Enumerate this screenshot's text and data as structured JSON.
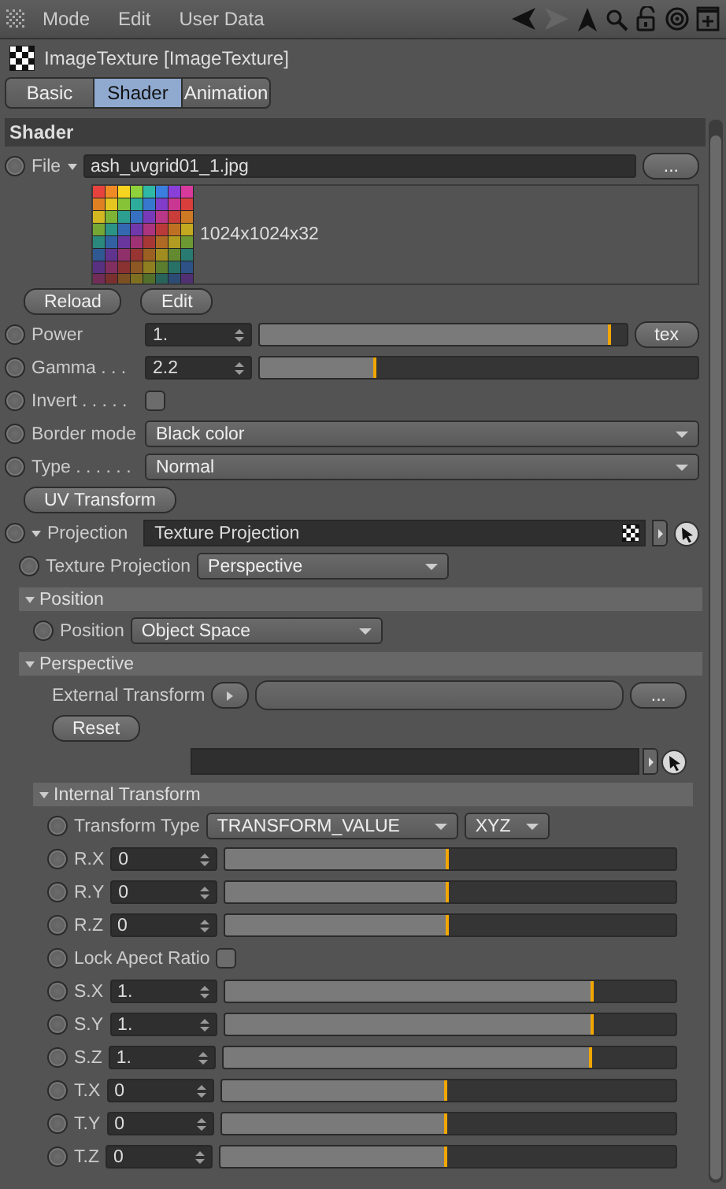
{
  "menu": {
    "items": [
      "Mode",
      "Edit",
      "User Data"
    ]
  },
  "object": {
    "title": "ImageTexture [ImageTexture]"
  },
  "tabs": [
    {
      "label": "Basic",
      "selected": false
    },
    {
      "label": "Shader",
      "selected": true
    },
    {
      "label": "Animation",
      "selected": false
    }
  ],
  "section": {
    "title": "Shader"
  },
  "file": {
    "label": "File",
    "keyed": false,
    "value": "ash_uvgrid01_1.jpg",
    "browse": "...",
    "resolution": "1024x1024x32",
    "buttons": [
      "Reload",
      "Edit"
    ]
  },
  "params": [
    {
      "kind": "slider",
      "label": "Power",
      "keyed": false,
      "value": "1.",
      "level": 0.95,
      "button": "tex"
    },
    {
      "kind": "slider",
      "label": "Gamma . . .",
      "keyed": false,
      "value": "2.2",
      "level": 0.26
    },
    {
      "kind": "checkbox",
      "label": "Invert . . . . .",
      "keyed": false,
      "checked": false
    },
    {
      "kind": "dropdown",
      "label": "Border mode",
      "keyed": false,
      "value": "Black color"
    },
    {
      "kind": "dropdown",
      "label": "Type . . . . . .",
      "keyed": false,
      "value": "Normal"
    },
    {
      "kind": "button",
      "label": "UV Transform"
    },
    {
      "kind": "link",
      "label": "Projection",
      "keyed": false,
      "value": "Texture Projection",
      "expanded": true,
      "children": [
        {
          "kind": "dropdown",
          "label": "Texture Projection",
          "keyed": false,
          "value": "Perspective"
        },
        {
          "kind": "group",
          "label": "Position",
          "expanded": true,
          "children": [
            {
              "kind": "dropdown",
              "label": "Position",
              "keyed": false,
              "value": "Object Space"
            }
          ]
        },
        {
          "kind": "group",
          "label": "Perspective",
          "expanded": true,
          "children": [
            {
              "kind": "transform_link",
              "label": "External Transform",
              "browse": "..."
            },
            {
              "kind": "button",
              "label": "Reset"
            },
            {
              "kind": "link_field"
            },
            {
              "kind": "group",
              "label": "Internal Transform",
              "expanded": true,
              "children": [
                {
                  "kind": "dropdown_pair",
                  "label": "Transform Type",
                  "keyed": false,
                  "value": "TRANSFORM_VALUE",
                  "value2": "XYZ"
                },
                {
                  "kind": "slider",
                  "label": "R.X",
                  "keyed": false,
                  "value": "0",
                  "level": 0.49
                },
                {
                  "kind": "slider",
                  "label": "R.Y",
                  "keyed": false,
                  "value": "0",
                  "level": 0.49
                },
                {
                  "kind": "slider",
                  "label": "R.Z",
                  "keyed": false,
                  "value": "0",
                  "level": 0.49
                },
                {
                  "kind": "checkbox",
                  "label": "Lock Apect Ratio",
                  "keyed": false,
                  "checked": false
                },
                {
                  "kind": "slider",
                  "label": "S.X",
                  "keyed": false,
                  "value": "1.",
                  "level": 0.81
                },
                {
                  "kind": "slider",
                  "label": "S.Y",
                  "keyed": false,
                  "value": "1.",
                  "level": 0.81
                },
                {
                  "kind": "slider",
                  "label": "S.Z",
                  "keyed": false,
                  "value": "1.",
                  "level": 0.81
                },
                {
                  "kind": "slider",
                  "label": "T.X",
                  "keyed": false,
                  "value": "0",
                  "level": 0.49
                },
                {
                  "kind": "slider",
                  "label": "T.Y",
                  "keyed": false,
                  "value": "0",
                  "level": 0.49
                },
                {
                  "kind": "slider",
                  "label": "T.Z",
                  "keyed": false,
                  "value": "0",
                  "level": 0.49
                }
              ]
            }
          ]
        }
      ]
    }
  ]
}
